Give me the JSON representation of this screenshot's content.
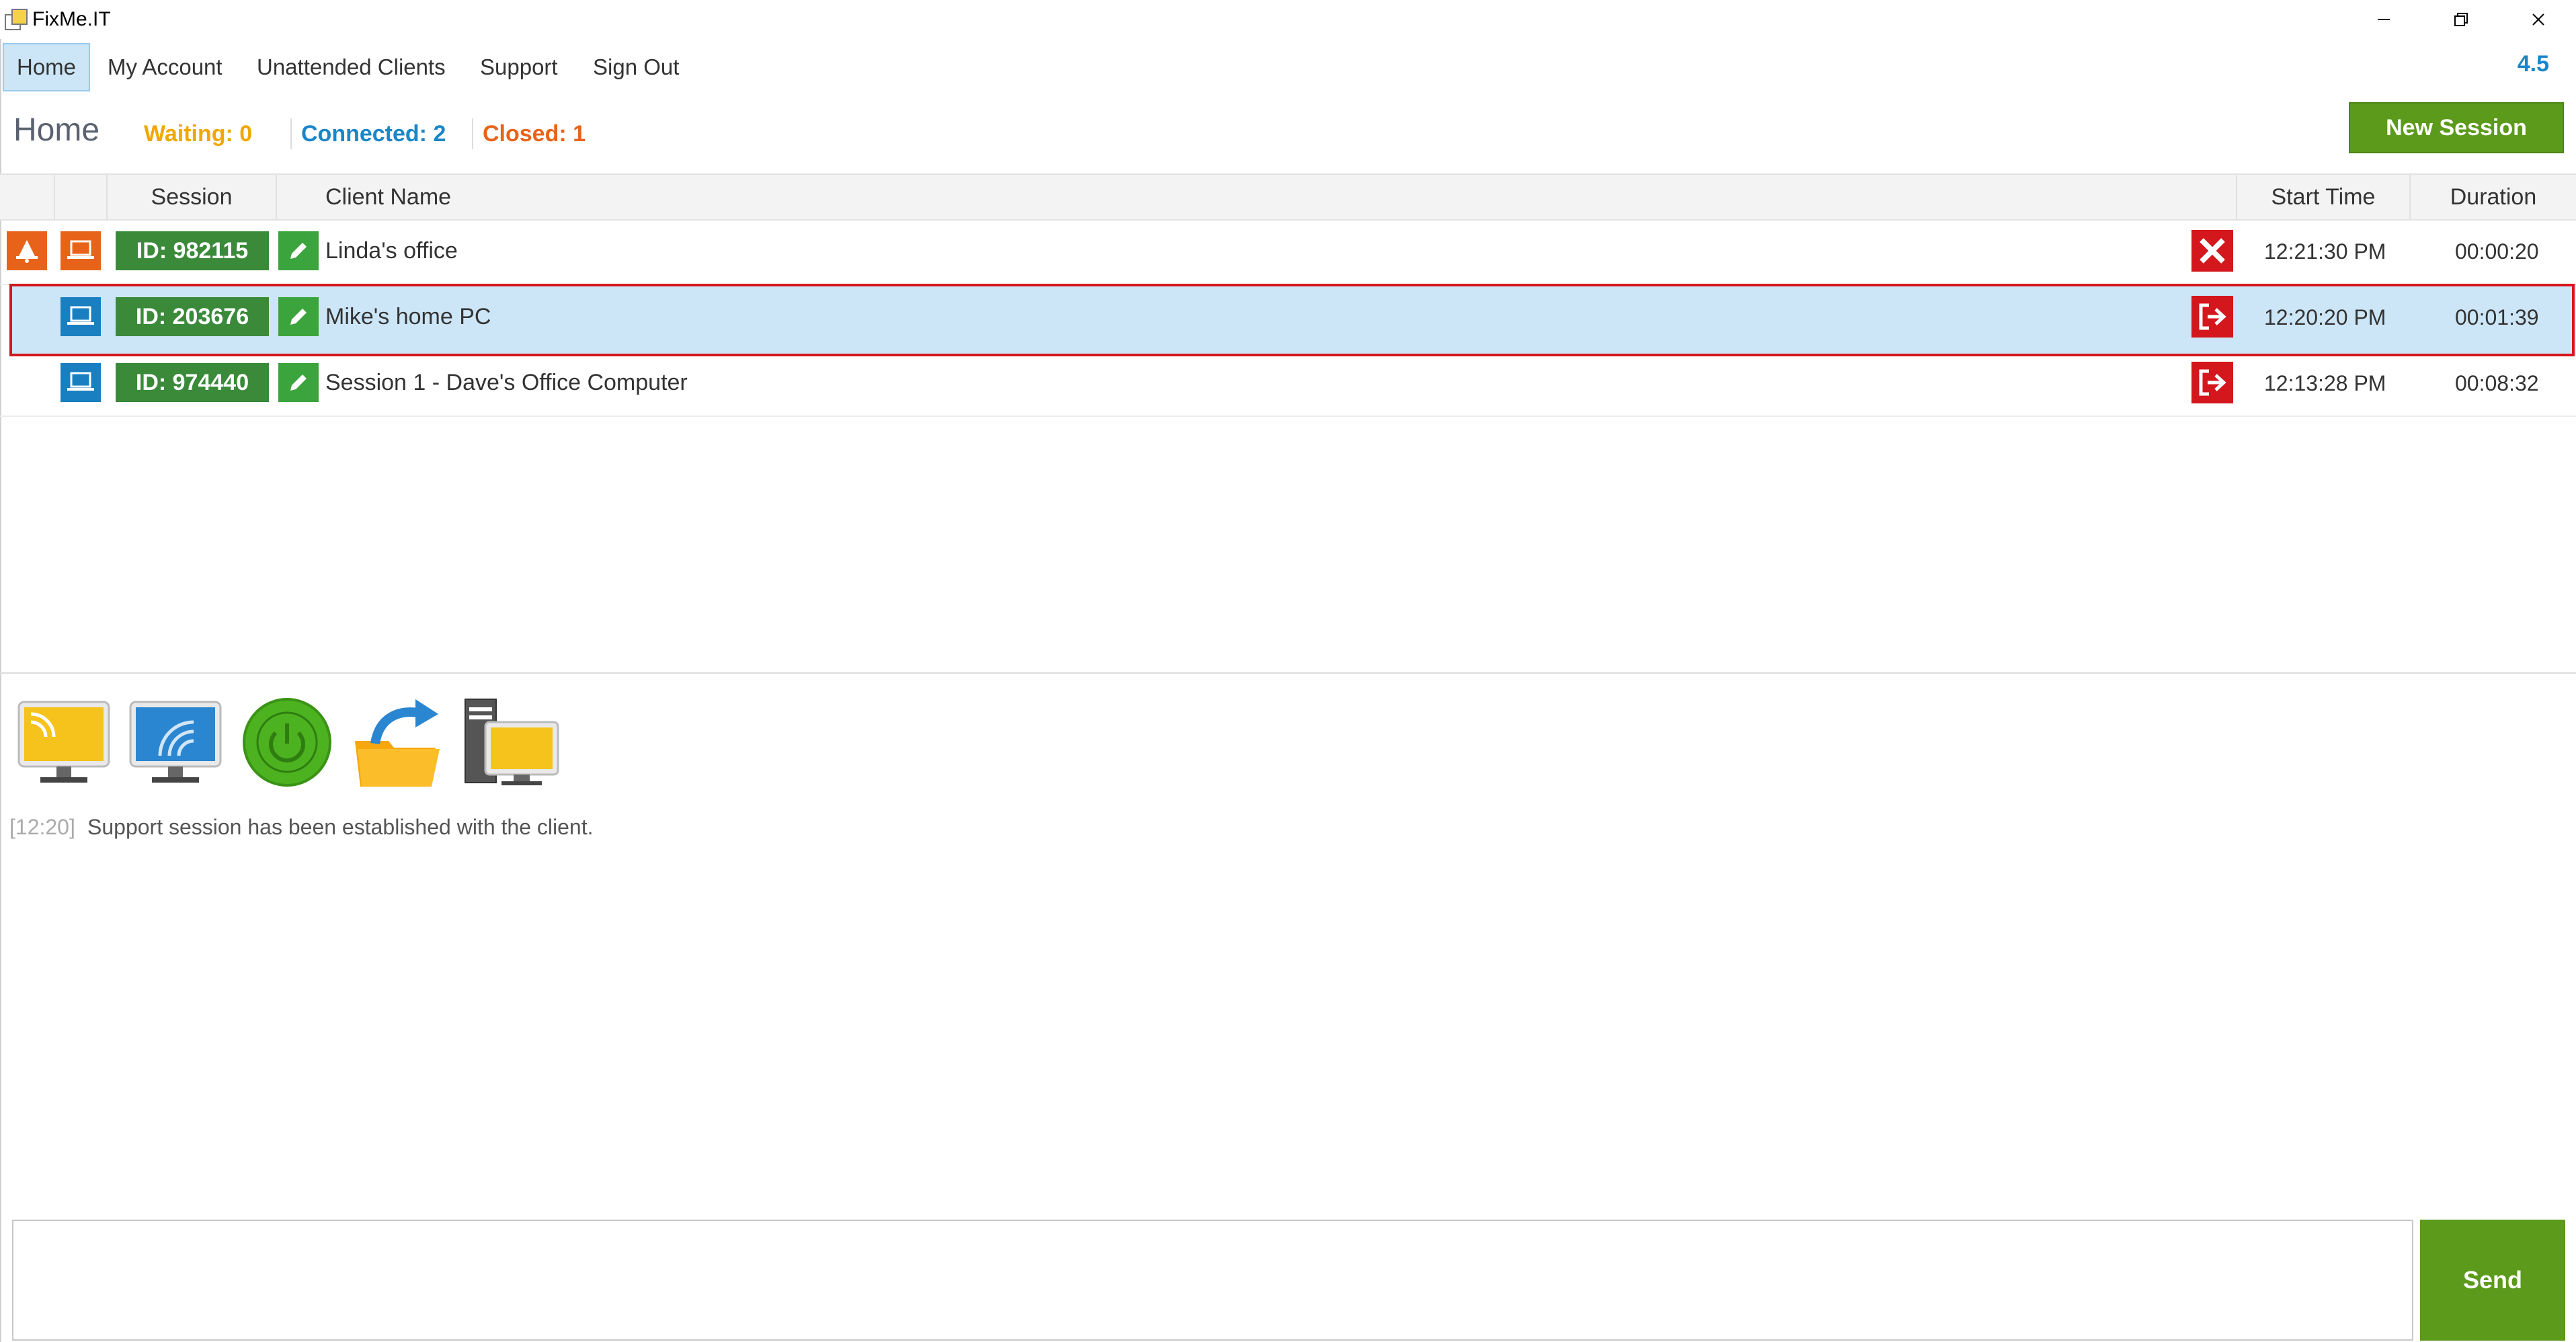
{
  "window": {
    "title": "FixMe.IT"
  },
  "menu": {
    "items": [
      {
        "label": "Home"
      },
      {
        "label": "My Account"
      },
      {
        "label": "Unattended Clients"
      },
      {
        "label": "Support"
      },
      {
        "label": "Sign Out"
      }
    ],
    "version": "4.5"
  },
  "header": {
    "title": "Home",
    "waiting": "Waiting: 0",
    "connected": "Connected: 2",
    "closed": "Closed: 1",
    "new_session": "New Session"
  },
  "table": {
    "columns": [
      "Session",
      "Client Name",
      "Start Time",
      "Duration"
    ],
    "rows": [
      {
        "id": "ID: 982115",
        "client": "Linda's office",
        "start": "12:21:30 PM",
        "duration": "00:00:20",
        "status": "closed",
        "action_icon": "close-icon"
      },
      {
        "id": "ID: 203676",
        "client": "Mike's home PC",
        "start": "12:20:20 PM",
        "duration": "00:01:39",
        "status": "connected",
        "action_icon": "exit-icon"
      },
      {
        "id": "ID: 974440",
        "client": "Session 1 - Dave's Office Computer",
        "start": "12:13:28 PM",
        "duration": "00:08:32",
        "status": "connected",
        "action_icon": "exit-icon"
      }
    ]
  },
  "toolbar": {
    "icons": [
      "remote-desktop-icon",
      "screen-share-icon",
      "power-icon",
      "file-transfer-icon",
      "system-info-icon"
    ]
  },
  "log": {
    "time": "[12:20]",
    "message": "Support session has been established with the client."
  },
  "chat": {
    "send_label": "Send"
  },
  "colors": {
    "accent_green": "#5c9a1b",
    "badge_green": "#3a8a3a",
    "waiting": "#f0a800",
    "connected": "#1a86c8",
    "closed": "#e8631a",
    "danger": "#d4161d",
    "selection": "#cde6f7"
  }
}
